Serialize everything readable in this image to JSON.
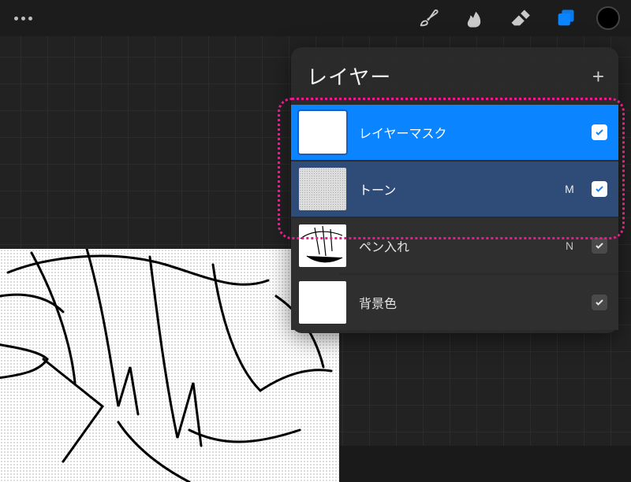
{
  "toolbar": {
    "menu_icon": "ellipsis",
    "tools": [
      {
        "name": "brush-tool-button",
        "icon": "brush",
        "active": false
      },
      {
        "name": "smudge-tool-button",
        "icon": "smudge",
        "active": false
      },
      {
        "name": "eraser-tool-button",
        "icon": "eraser",
        "active": false
      },
      {
        "name": "layers-button",
        "icon": "layers",
        "active": true
      }
    ],
    "swatch_color": "#000000"
  },
  "layers_panel": {
    "title": "レイヤー",
    "add_label": "+",
    "layers": [
      {
        "name": "レイヤーマスク",
        "blend": "",
        "visible": true,
        "selected": "bright",
        "thumb": "white"
      },
      {
        "name": "トーン",
        "blend": "M",
        "visible": true,
        "selected": "dim",
        "thumb": "tone"
      },
      {
        "name": "ペン入れ",
        "blend": "N",
        "visible": true,
        "selected": "none",
        "thumb": "ink"
      },
      {
        "name": "背景色",
        "blend": "",
        "visible": true,
        "selected": "none",
        "thumb": "white"
      }
    ]
  },
  "annotation": {
    "purpose": "highlight-selected-layers",
    "color": "#e61e8c"
  }
}
